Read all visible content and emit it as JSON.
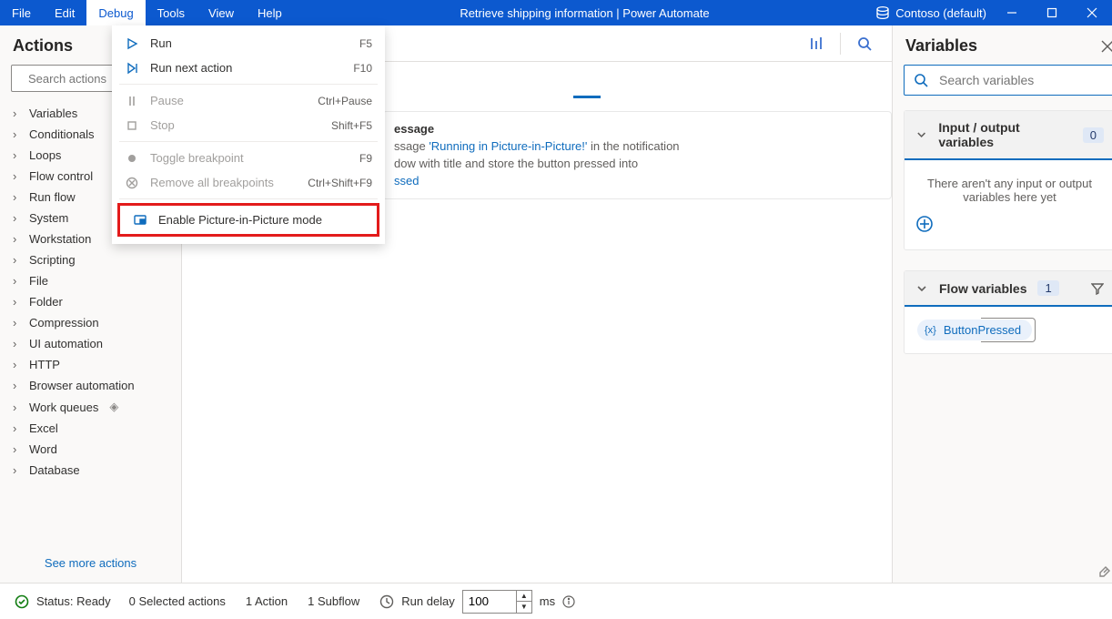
{
  "menubar": [
    "File",
    "Edit",
    "Debug",
    "Tools",
    "View",
    "Help"
  ],
  "active_menu_index": 2,
  "window_title": "Retrieve shipping information | Power Automate",
  "account": "Contoso (default)",
  "actions": {
    "title": "Actions",
    "search_placeholder": "Search actions",
    "categories": [
      "Variables",
      "Conditionals",
      "Loops",
      "Flow control",
      "Run flow",
      "System",
      "Workstation",
      "Scripting",
      "File",
      "Folder",
      "Compression",
      "UI automation",
      "HTTP",
      "Browser automation",
      "Work queues",
      "Excel",
      "Word",
      "Database"
    ],
    "premium_index": 14,
    "see_more": "See more actions"
  },
  "debug_menu": [
    {
      "label": "Run",
      "shortcut": "F5",
      "icon": "play",
      "enabled": true
    },
    {
      "label": "Run next action",
      "shortcut": "F10",
      "icon": "step",
      "enabled": true
    },
    {
      "label": "Pause",
      "shortcut": "Ctrl+Pause",
      "icon": "pause",
      "enabled": false
    },
    {
      "label": "Stop",
      "shortcut": "Shift+F5",
      "icon": "stop",
      "enabled": false
    },
    {
      "label": "Toggle breakpoint",
      "shortcut": "F9",
      "icon": "dot",
      "enabled": false
    },
    {
      "label": "Remove all breakpoints",
      "shortcut": "Ctrl+Shift+F9",
      "icon": "clear",
      "enabled": false
    },
    {
      "label": "Enable Picture-in-Picture mode",
      "shortcut": "",
      "icon": "pip",
      "enabled": true,
      "highlight": true
    }
  ],
  "flow_card": {
    "title_suffix": "essage",
    "line1_a": "ssage ",
    "line1_link": "'Running in Picture-in-Picture!'",
    "line1_b": " in the notification",
    "line2": "dow with title  and store the button pressed into",
    "line3_link": "ssed"
  },
  "variables": {
    "title": "Variables",
    "search_placeholder": "Search variables",
    "io_group": "Input / output variables",
    "io_count": "0",
    "io_empty": "There aren't any input or output variables here yet",
    "flow_group": "Flow variables",
    "flow_count": "1",
    "flow_vars": [
      "ButtonPressed"
    ]
  },
  "statusbar": {
    "status": "Status: Ready",
    "selected": "0 Selected actions",
    "actions": "1 Action",
    "subflows": "1 Subflow",
    "run_delay": "Run delay",
    "delay_value": "100",
    "delay_unit": "ms"
  }
}
